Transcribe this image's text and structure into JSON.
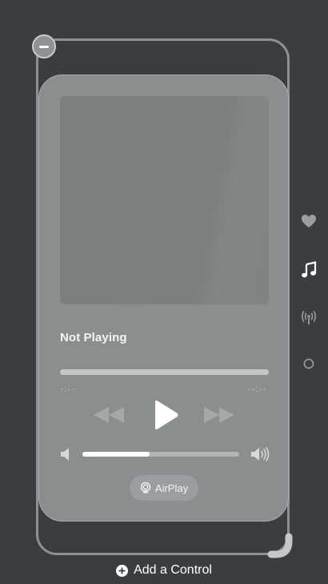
{
  "player": {
    "title": "Not Playing",
    "elapsed": "-:--",
    "remaining": "--:--",
    "volume_level": 0.43,
    "airplay_label": "AirPlay"
  },
  "footer": {
    "add_control_label": "Add a Control"
  },
  "icons": {
    "remove": "minus-circle-icon",
    "rewind": "rewind-icon",
    "play": "play-icon",
    "forward": "fast-forward-icon",
    "volume_low": "speaker-low-icon",
    "volume_high": "speaker-high-icon",
    "airplay": "airplay-icon",
    "side_items": [
      "heart-icon",
      "music-note-icon",
      "antenna-icon",
      "circle-icon"
    ],
    "add": "plus-circle-icon"
  },
  "colors": {
    "background": "#3b3e40",
    "card": "#8a8e8f",
    "accent": "#ffffff"
  }
}
